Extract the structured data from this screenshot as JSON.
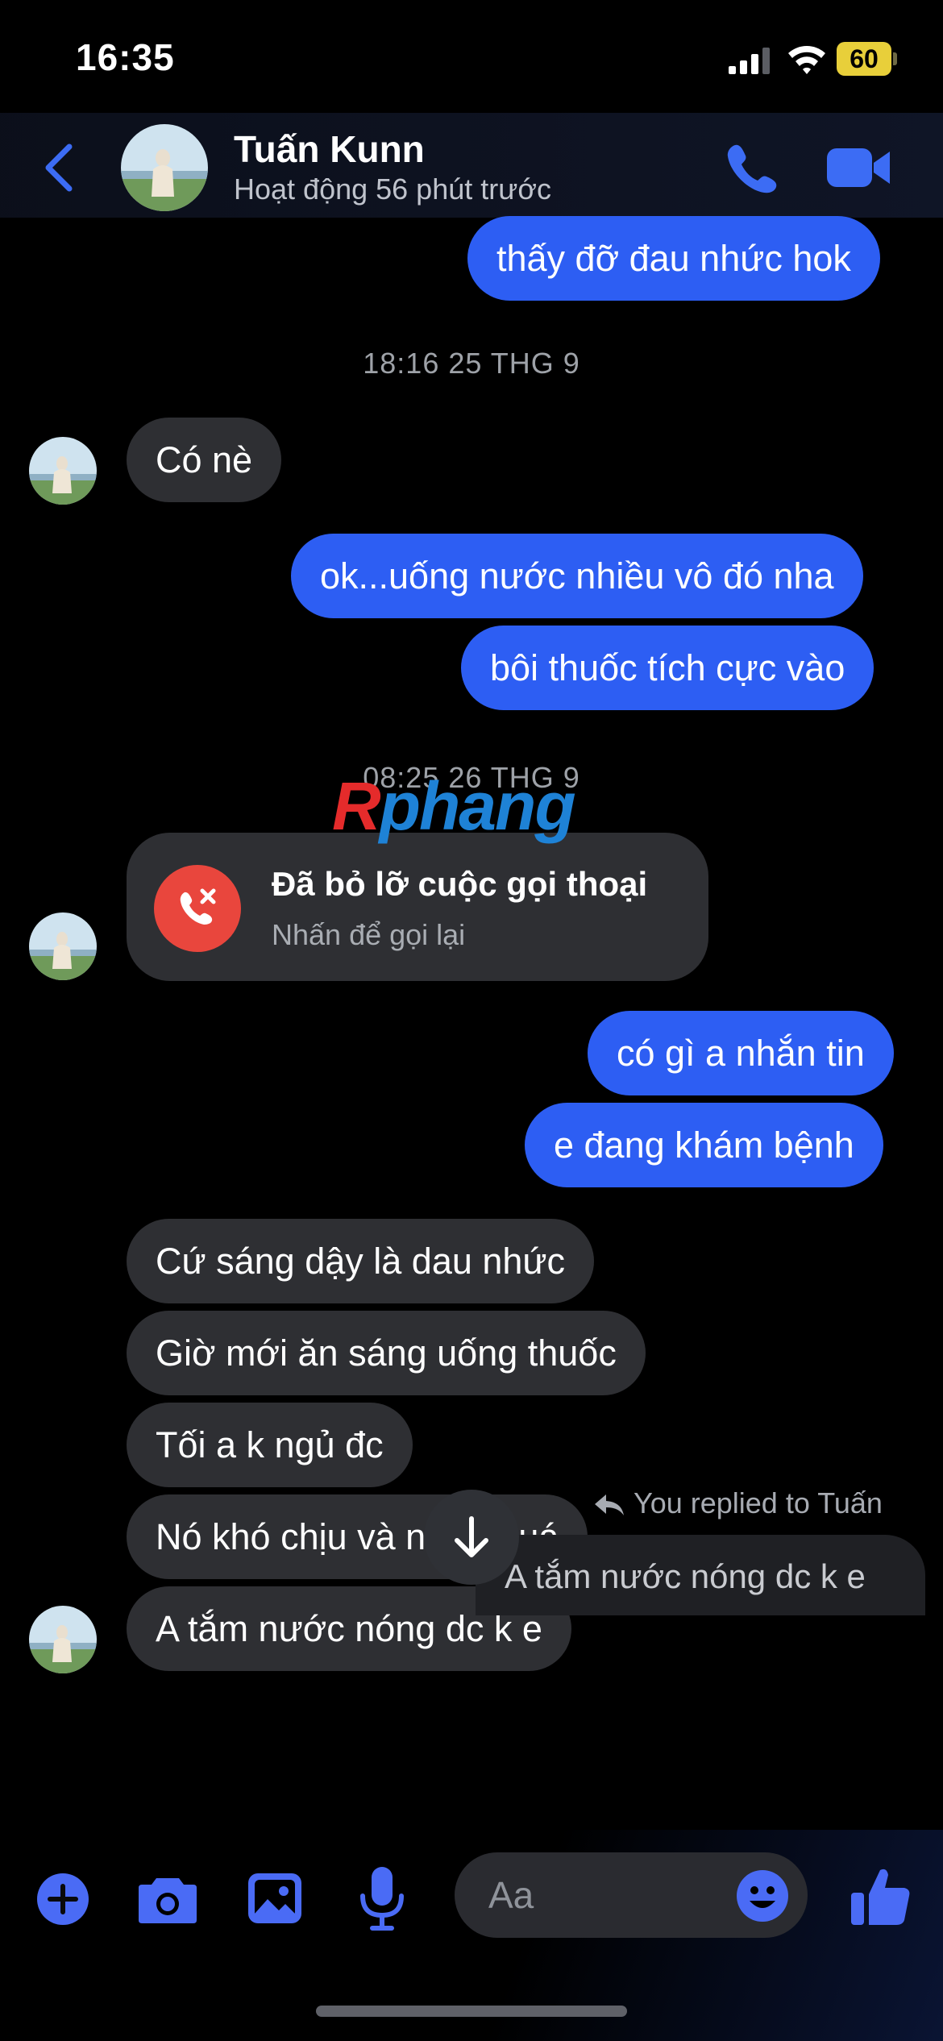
{
  "status_bar": {
    "time": "16:35",
    "battery": "60"
  },
  "header": {
    "name": "Tuấn Kunn",
    "activity": "Hoạt động 56 phút trước"
  },
  "messages": [
    {
      "side": "out",
      "text": "thấy đỡ đau nhức hok"
    },
    {
      "side": "stamp",
      "text": "18:16 25 THG 9"
    },
    {
      "side": "in",
      "text": "Có nè"
    },
    {
      "side": "out",
      "text": "ok...uống nước nhiều vô đó nha"
    },
    {
      "side": "out",
      "text": "bôi thuốc tích cực vào"
    },
    {
      "side": "stamp",
      "text": "08:25 26 THG 9"
    },
    {
      "side": "out",
      "text": "có gì a nhắn tin"
    },
    {
      "side": "out",
      "text": "e đang khám bệnh"
    },
    {
      "side": "in",
      "text": "Cứ sáng dậy là dau nhức"
    },
    {
      "side": "in",
      "text": "Giờ mới ăn sáng uống thuốc"
    },
    {
      "side": "in",
      "text": "Tối a k ngủ đc"
    },
    {
      "side": "in",
      "text": "Nó khó chịu và nhức quá"
    },
    {
      "side": "in",
      "text": "A tắm nước nóng dc k e"
    }
  ],
  "missed_call": {
    "title": "Đã bỏ lỡ cuộc gọi thoại",
    "subtitle": "Nhấn để gọi lại"
  },
  "watermark": {
    "first": "R",
    "rest": "phang"
  },
  "reply": {
    "label": "You replied to Tuấn",
    "quoted": "A tắm nước nóng dc k e"
  },
  "composer": {
    "placeholder": "Aa"
  },
  "colors": {
    "outgoing": "#2d5ef3",
    "incoming": "#2e2f33",
    "accent": "#4a6bf5",
    "missed_call": "#e9463d"
  },
  "icons": [
    "back-chevron-icon",
    "phone-icon",
    "video-camera-icon",
    "missed-call-icon",
    "arrow-down-icon",
    "reply-arrow-icon",
    "plus-icon",
    "camera-icon",
    "gallery-icon",
    "microphone-icon",
    "emoji-icon",
    "thumbs-up-icon"
  ]
}
